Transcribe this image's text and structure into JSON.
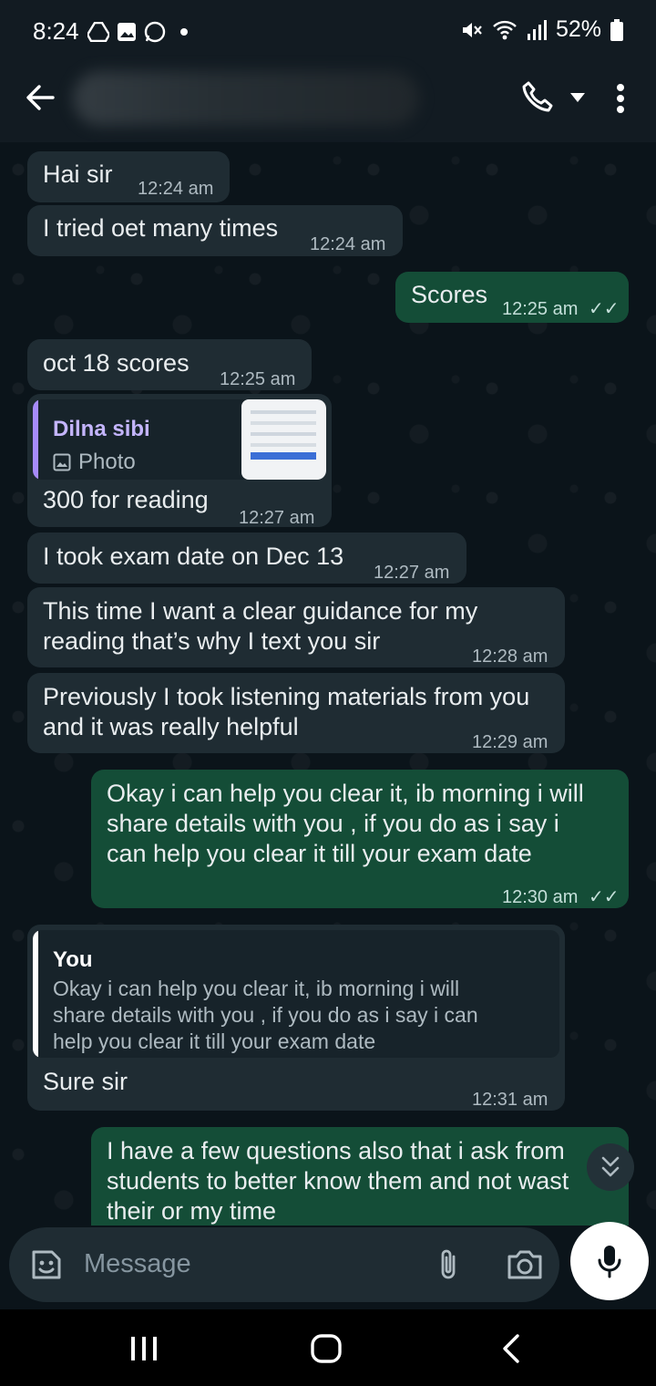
{
  "status_bar": {
    "time": "8:24",
    "battery": "52%",
    "icons": [
      "drive-icon",
      "image-icon",
      "whatsapp-icon",
      "dot-icon",
      "mute-icon",
      "wifi-icon",
      "signal-icon",
      "battery-icon"
    ]
  },
  "header": {
    "icons": [
      "back-arrow-icon",
      "phone-icon",
      "chevron-down-icon",
      "more-vertical-icon"
    ]
  },
  "messages": [
    {
      "dir": "in",
      "text": "Hai sir",
      "time": "12:24 am"
    },
    {
      "dir": "in",
      "text": "I tried oet many times",
      "time": "12:24 am"
    },
    {
      "dir": "out",
      "text": "Scores",
      "time": "12:25 am"
    },
    {
      "dir": "in",
      "text": "oct 18 scores",
      "time": "12:25 am"
    },
    {
      "dir": "in",
      "quote_author": "Dilna sibi",
      "quote_text": "Photo",
      "text": "300 for reading",
      "time": "12:27 am"
    },
    {
      "dir": "in",
      "text": "I took exam date on Dec 13",
      "time": "12:27 am"
    },
    {
      "dir": "in",
      "text": "This time I want a clear guidance for my\nreading that’s why I text you sir",
      "time": "12:28 am"
    },
    {
      "dir": "in",
      "text": "Previously I took listening materials from you\nand it was really helpful",
      "time": "12:29 am"
    },
    {
      "dir": "out",
      "text": "Okay i can help  you clear it, ib morning i will\nshare details with you , if you do as i say i\ncan help you clear it till your exam date",
      "time": "12:30 am"
    },
    {
      "dir": "in",
      "quote_author": "You",
      "quote_text": "Okay i can help  you clear it, ib morning i will\nshare details with you , if you do as i say i can\nhelp you clear it till your exam date",
      "text": "Sure sir",
      "time": "12:31 am"
    },
    {
      "dir": "out",
      "text": "I have a few questions also that i ask from\nstudents to better know them and not wast\ntheir or my time",
      "time": ""
    }
  ],
  "composer": {
    "placeholder": "Message",
    "icons": [
      "sticker-icon",
      "attach-icon",
      "camera-icon",
      "mic-icon"
    ]
  },
  "colors": {
    "background": "#0b141a",
    "incoming_bubble": "#1f2c33",
    "outgoing_bubble": "#005c4b",
    "quote_you": "#ffffff",
    "quote_other": "#a78bfa"
  }
}
